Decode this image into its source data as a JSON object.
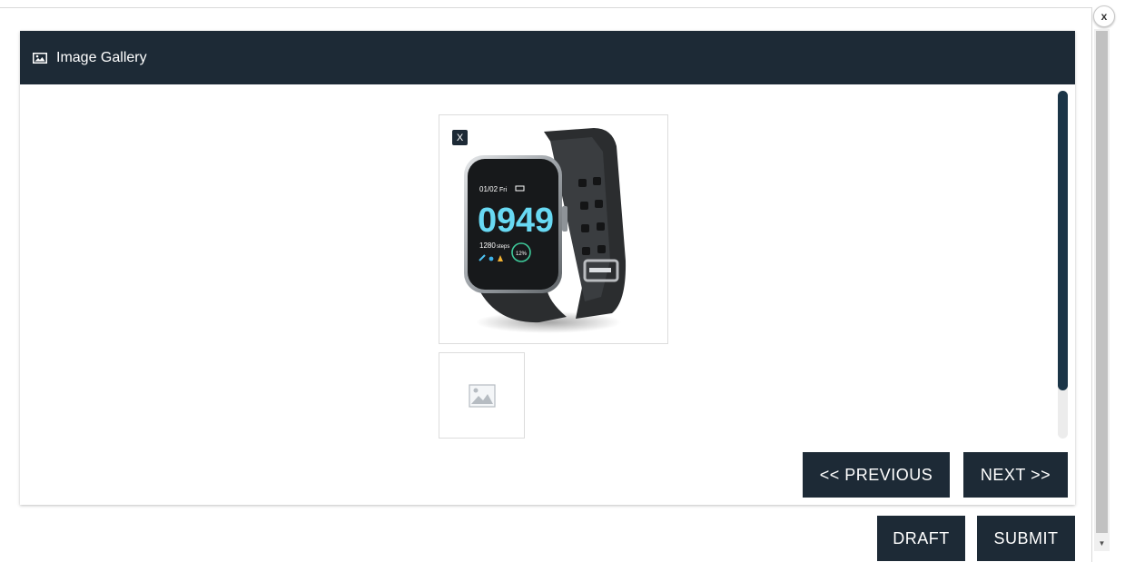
{
  "dialog": {
    "close_label": "x"
  },
  "panel": {
    "title": "Image Gallery",
    "icon": "image-icon"
  },
  "gallery": {
    "main_image": {
      "alt": "Smartwatch product photo",
      "screen_date": "01/02",
      "screen_day": "Fri",
      "screen_time": "0949",
      "screen_steps": "1280",
      "screen_steps_unit": "steps",
      "screen_ring_value": "12%",
      "remove_label": "X"
    },
    "thumbnail": {
      "icon": "image-placeholder-icon"
    }
  },
  "navigation": {
    "previous_label": "<< PREVIOUS",
    "next_label": "NEXT >>"
  },
  "actions": {
    "draft_label": "DRAFT",
    "submit_label": "SUBMIT"
  },
  "colors": {
    "header_bg": "#1d2a36",
    "button_bg": "#1d2a36",
    "scroll_thumb": "#1b3547"
  }
}
